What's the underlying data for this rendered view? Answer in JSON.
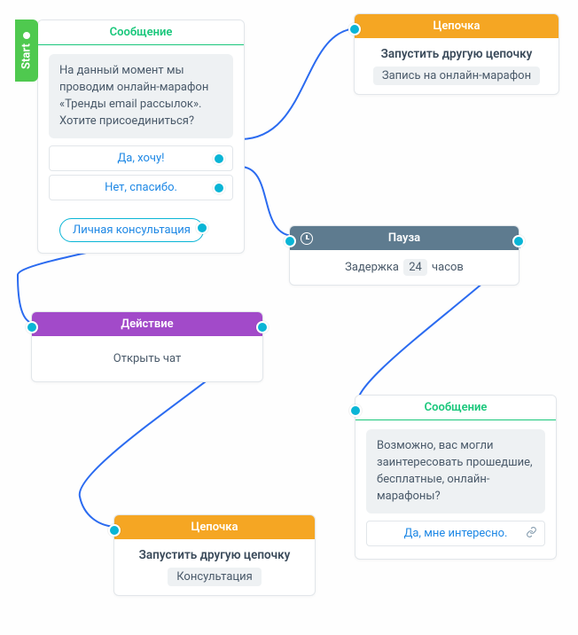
{
  "startLabel": "Start",
  "msg1": {
    "header": "Сообщение",
    "text": "На данный момент мы проводим онлайн-марафон «Тренды email рассылок». Хотите присоединиться?",
    "opt1": "Да, хочу!",
    "opt2": "Нет, спасибо.",
    "consult": "Личная консультация"
  },
  "chain1": {
    "header": "Цепочка",
    "title": "Запустить другую цепочку",
    "value": "Запись на онлайн-марафон"
  },
  "pause": {
    "header": "Пауза",
    "prefix": "Задержка",
    "value": "24",
    "suffix": "часов"
  },
  "action": {
    "header": "Действие",
    "text": "Открыть чат"
  },
  "msg2": {
    "header": "Сообщение",
    "text": "Возможно, вас могли заинтересовать прошедшие, бесплатные, онлайн-марафоны?",
    "opt1": "Да, мне интересно."
  },
  "chain2": {
    "header": "Цепочка",
    "title": "Запустить другую цепочку",
    "value": "Консультация"
  }
}
